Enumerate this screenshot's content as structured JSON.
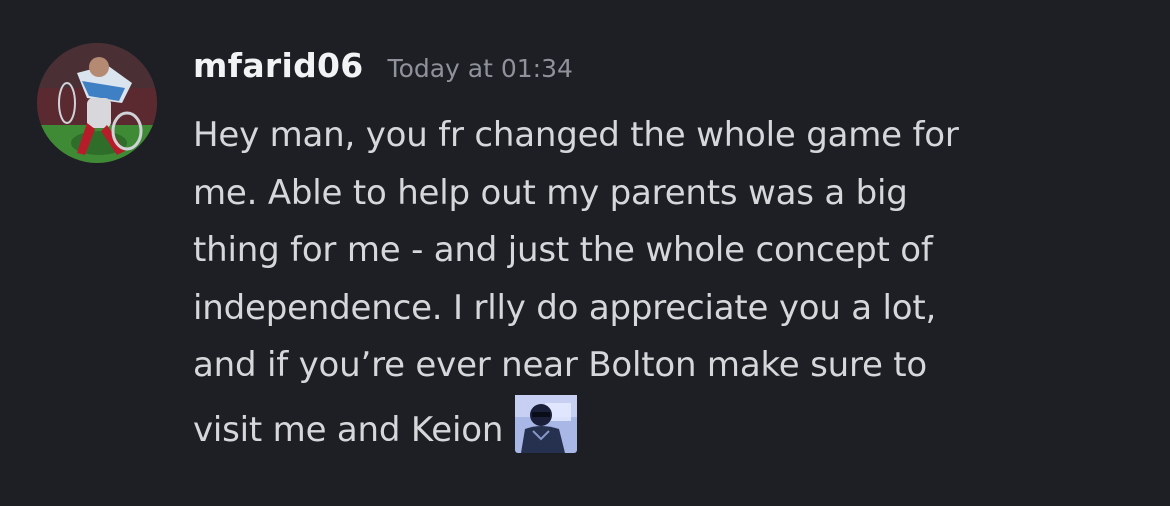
{
  "message": {
    "author": "mfarid06",
    "timestamp": "Today at 01:34",
    "content_lines": [
      "Hey man, you fr changed the whole game for",
      "me. Able to help out my parents was a big",
      "thing for me - and just the whole concept of",
      "independence. I rlly do appreciate you a lot,",
      "and if you’re ever near Bolton make sure to",
      "visit me and Keion"
    ],
    "custom_emoji": "person-photo-emoji"
  }
}
